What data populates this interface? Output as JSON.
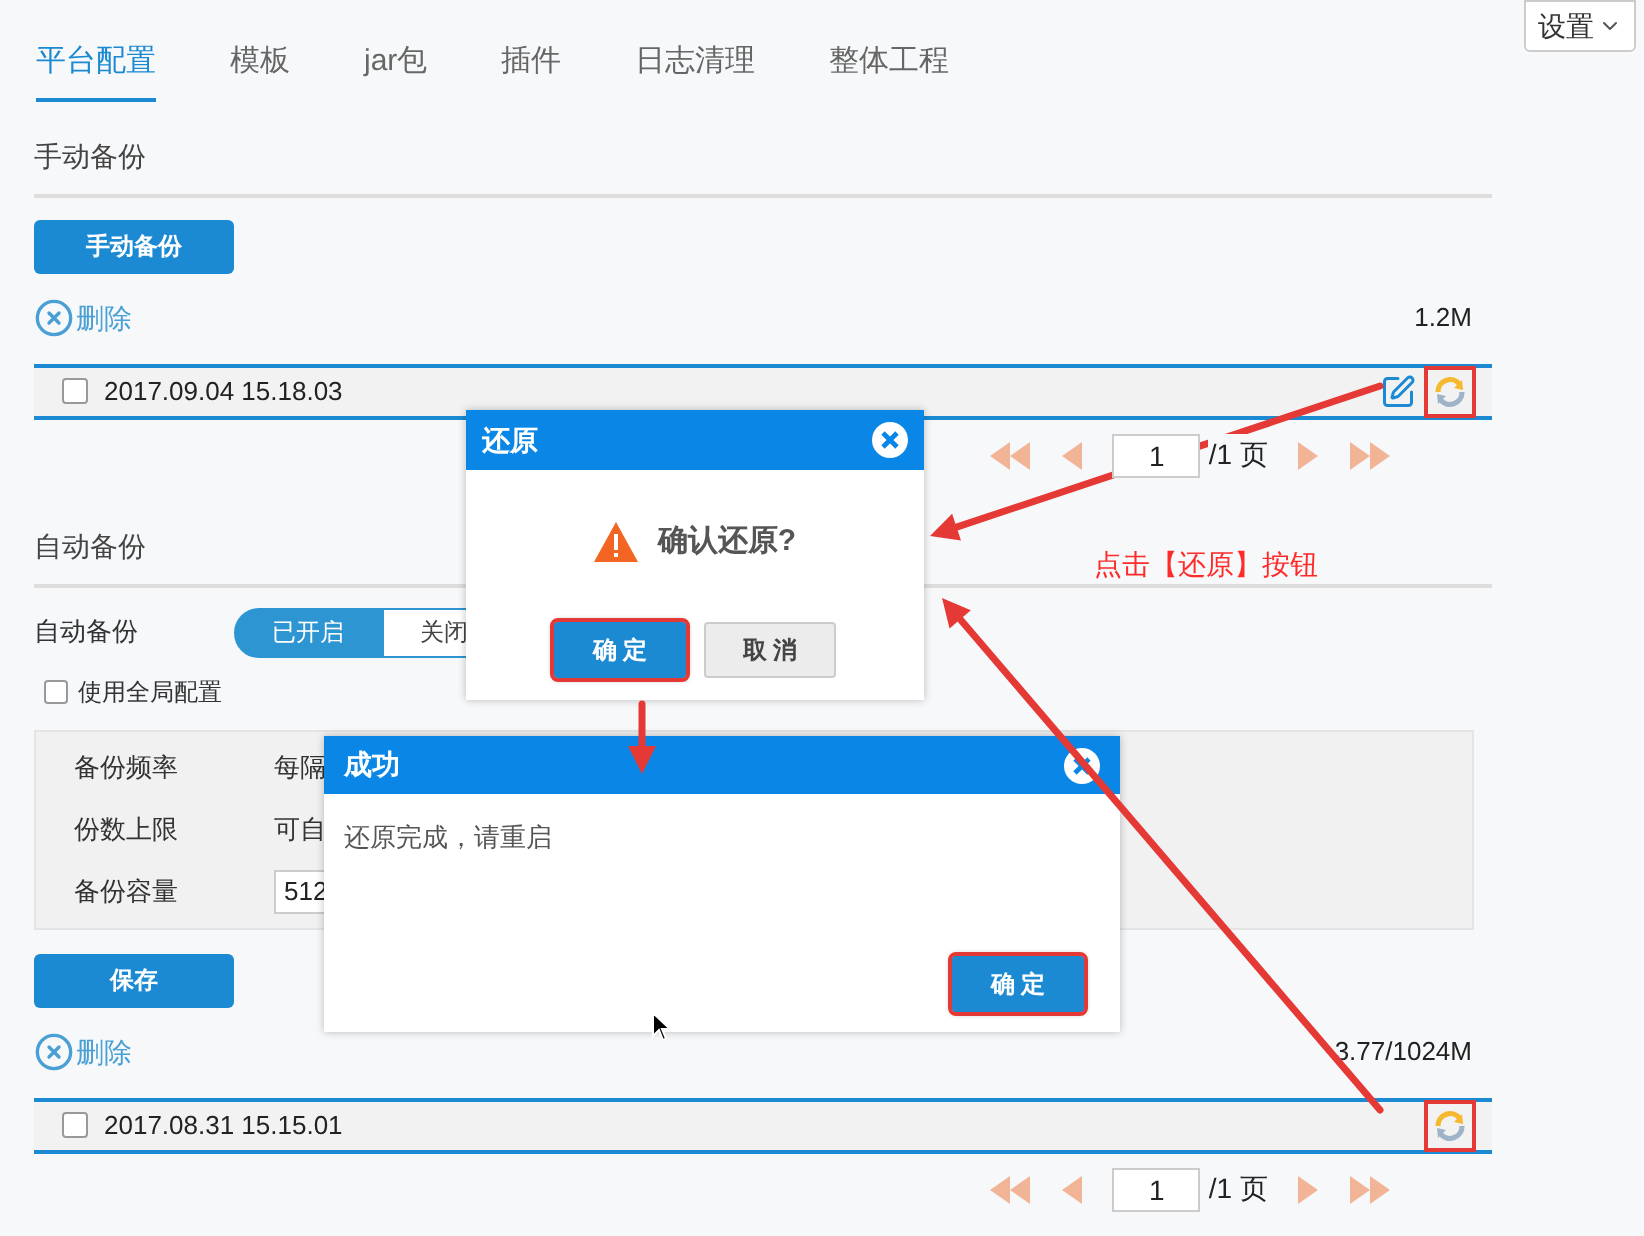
{
  "tabs": [
    {
      "label": "平台配置",
      "selected": true
    },
    {
      "label": "模板",
      "selected": false
    },
    {
      "label": "jar包",
      "selected": false
    },
    {
      "label": "插件",
      "selected": false
    },
    {
      "label": "日志清理",
      "selected": false
    },
    {
      "label": "整体工程",
      "selected": false
    }
  ],
  "settings_button": {
    "label": "设置"
  },
  "manual_backup": {
    "title": "手动备份",
    "button": "手动备份",
    "delete": "删除",
    "size": "1.2M",
    "rows": [
      {
        "checked": false,
        "date": "2017.09.04 15.18.03",
        "editable": true,
        "highlighted": true
      }
    ],
    "pager": {
      "page": "1",
      "total": "/1 页"
    }
  },
  "auto_backup": {
    "title": "自动备份",
    "switch_label": "自动备份",
    "switch_options": [
      {
        "label": "已开启",
        "selected": true
      },
      {
        "label": "关闭",
        "selected": false
      }
    ],
    "use_global": {
      "label": "使用全局配置",
      "checked": false
    },
    "settings": [
      {
        "label": "备份频率",
        "value": "每隔",
        "kind": "select"
      },
      {
        "label": "份数上限",
        "value": "可自",
        "kind": "text"
      },
      {
        "label": "备份容量",
        "value": "512",
        "kind": "input"
      }
    ],
    "save_button": "保存",
    "delete": "删除",
    "size": "3.77/1024M",
    "rows": [
      {
        "checked": false,
        "date": "2017.08.31 15.15.01",
        "editable": false,
        "highlighted": true
      }
    ],
    "pager": {
      "page": "1",
      "total": "/1 页"
    }
  },
  "restore_dialog": {
    "title": "还原",
    "message": "确认还原?",
    "buttons": [
      {
        "label": "确 定",
        "kind": "primary",
        "highlighted": true
      },
      {
        "label": "取 消",
        "kind": "secondary",
        "highlighted": false
      }
    ]
  },
  "success_dialog": {
    "title": "成功",
    "message": "还原完成，请重启",
    "buttons": [
      {
        "label": "确 定",
        "kind": "primary",
        "highlighted": true
      }
    ]
  },
  "annotation": "点击【还原】按钮"
}
